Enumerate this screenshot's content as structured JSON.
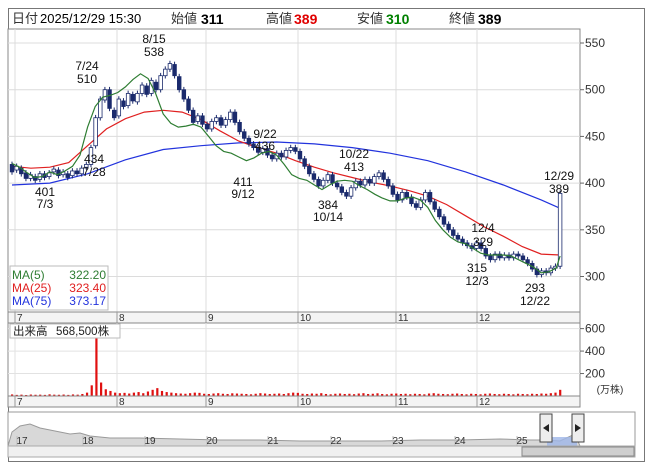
{
  "header": {
    "date_label": "日付",
    "date_value": "2025/12/29 15:30",
    "open_label": "始値",
    "open_value": "311",
    "high_label": "高値",
    "high_value": "389",
    "low_label": "安値",
    "low_value": "310",
    "close_label": "終値",
    "close_value": "389",
    "colors": {
      "high": "#e00000",
      "low": "#008000",
      "default": "#000000"
    }
  },
  "chart_data": [
    {
      "type": "candlestick",
      "title": "",
      "x_months": [
        "7",
        "8",
        "9",
        "10",
        "11",
        "12"
      ],
      "y_ticks": [
        300,
        350,
        400,
        450,
        500,
        550
      ],
      "ylim": [
        262,
        565
      ],
      "annotations": [
        {
          "date": "7/3",
          "value": "401"
        },
        {
          "date": "7/24",
          "value": "510"
        },
        {
          "date": "7/28",
          "value": "434"
        },
        {
          "date": "8/15",
          "value": "538"
        },
        {
          "date": "9/12",
          "value": "411"
        },
        {
          "date": "9/22",
          "value": "436"
        },
        {
          "date": "10/14",
          "value": "384"
        },
        {
          "date": "10/22",
          "value": "413"
        },
        {
          "date": "12/3",
          "value": "315"
        },
        {
          "date": "12/4",
          "value": "329"
        },
        {
          "date": "12/22",
          "value": "293"
        },
        {
          "date": "12/29",
          "value": "389"
        }
      ],
      "legend": [
        {
          "name": "MA(5)",
          "value": "322.20",
          "color": "#2e7d32"
        },
        {
          "name": "MA(25)",
          "value": "323.40",
          "color": "#e02020"
        },
        {
          "name": "MA(75)",
          "value": "373.17",
          "color": "#2233dd"
        }
      ],
      "ma5": [
        [
          0,
          421
        ],
        [
          2,
          417
        ],
        [
          4,
          411
        ],
        [
          6,
          406
        ],
        [
          8,
          407
        ],
        [
          10,
          412
        ],
        [
          12,
          409
        ],
        [
          14,
          413
        ],
        [
          16,
          418
        ],
        [
          18,
          430
        ],
        [
          20,
          460
        ],
        [
          22,
          482
        ],
        [
          24,
          492
        ],
        [
          26,
          494
        ],
        [
          28,
          497
        ],
        [
          30,
          503
        ],
        [
          32,
          511
        ],
        [
          34,
          517
        ],
        [
          36,
          512
        ],
        [
          38,
          496
        ],
        [
          40,
          474
        ],
        [
          42,
          464
        ],
        [
          44,
          460
        ],
        [
          46,
          461
        ],
        [
          48,
          463
        ],
        [
          50,
          460
        ],
        [
          52,
          450
        ],
        [
          54,
          440
        ],
        [
          56,
          434
        ],
        [
          58,
          432
        ],
        [
          60,
          428
        ],
        [
          62,
          424
        ],
        [
          64,
          427
        ],
        [
          66,
          432
        ],
        [
          68,
          434
        ],
        [
          70,
          430
        ],
        [
          72,
          420
        ],
        [
          74,
          409
        ],
        [
          76,
          405
        ],
        [
          78,
          403
        ],
        [
          80,
          398
        ],
        [
          82,
          393
        ],
        [
          84,
          398
        ],
        [
          86,
          402
        ],
        [
          88,
          403
        ],
        [
          90,
          402
        ],
        [
          92,
          397
        ],
        [
          94,
          393
        ],
        [
          96,
          388
        ],
        [
          98,
          384
        ],
        [
          100,
          381
        ],
        [
          102,
          381
        ],
        [
          104,
          384
        ],
        [
          106,
          385
        ],
        [
          108,
          382
        ],
        [
          110,
          374
        ],
        [
          112,
          360
        ],
        [
          114,
          350
        ],
        [
          116,
          342
        ],
        [
          118,
          337
        ],
        [
          120,
          335
        ],
        [
          122,
          330
        ],
        [
          124,
          325
        ],
        [
          126,
          323
        ],
        [
          128,
          323
        ],
        [
          130,
          323
        ],
        [
          132,
          322
        ],
        [
          134,
          318
        ],
        [
          136,
          314
        ],
        [
          138,
          310
        ],
        [
          140,
          304
        ],
        [
          142,
          305
        ],
        [
          144,
          309
        ],
        [
          145,
          322
        ]
      ],
      "ma25": [
        [
          0,
          418
        ],
        [
          5,
          416
        ],
        [
          10,
          417
        ],
        [
          15,
          422
        ],
        [
          20,
          440
        ],
        [
          25,
          458
        ],
        [
          30,
          469
        ],
        [
          35,
          476
        ],
        [
          40,
          478
        ],
        [
          45,
          476
        ],
        [
          50,
          468
        ],
        [
          55,
          456
        ],
        [
          60,
          445
        ],
        [
          65,
          438
        ],
        [
          70,
          432
        ],
        [
          75,
          424
        ],
        [
          80,
          417
        ],
        [
          85,
          411
        ],
        [
          90,
          406
        ],
        [
          95,
          401
        ],
        [
          100,
          397
        ],
        [
          105,
          392
        ],
        [
          110,
          386
        ],
        [
          115,
          377
        ],
        [
          120,
          365
        ],
        [
          125,
          353
        ],
        [
          130,
          343
        ],
        [
          135,
          332
        ],
        [
          140,
          324
        ],
        [
          145,
          323
        ]
      ],
      "ma75": [
        [
          0,
          398
        ],
        [
          10,
          400
        ],
        [
          20,
          410
        ],
        [
          30,
          425
        ],
        [
          40,
          436
        ],
        [
          50,
          440
        ],
        [
          60,
          443
        ],
        [
          70,
          444
        ],
        [
          80,
          442
        ],
        [
          90,
          438
        ],
        [
          100,
          432
        ],
        [
          110,
          424
        ],
        [
          120,
          412
        ],
        [
          130,
          398
        ],
        [
          140,
          382
        ],
        [
          145,
          373
        ]
      ],
      "candles": [
        [
          0,
          420,
          412
        ],
        [
          1,
          414,
          418
        ],
        [
          2,
          416,
          410
        ],
        [
          3,
          411,
          405
        ],
        [
          4,
          405,
          409
        ],
        [
          5,
          407,
          403
        ],
        [
          6,
          404,
          410
        ],
        [
          7,
          410,
          406
        ],
        [
          8,
          407,
          411
        ],
        [
          9,
          412,
          415
        ],
        [
          10,
          414,
          408
        ],
        [
          11,
          409,
          412
        ],
        [
          12,
          410,
          406
        ],
        [
          13,
          408,
          413
        ],
        [
          14,
          413,
          410
        ],
        [
          15,
          410,
          416
        ],
        [
          16,
          417,
          420
        ],
        [
          17,
          420,
          438
        ],
        [
          18,
          440,
          470
        ],
        [
          19,
          470,
          490
        ],
        [
          20,
          489,
          500
        ],
        [
          21,
          500,
          480
        ],
        [
          22,
          478,
          470
        ],
        [
          23,
          472,
          490
        ],
        [
          24,
          488,
          482
        ],
        [
          25,
          483,
          496
        ],
        [
          26,
          495,
          488
        ],
        [
          27,
          487,
          496
        ],
        [
          28,
          496,
          505
        ],
        [
          29,
          504,
          495
        ],
        [
          30,
          496,
          510
        ],
        [
          31,
          508,
          500
        ],
        [
          32,
          500,
          515
        ],
        [
          33,
          515,
          522
        ],
        [
          34,
          522,
          528
        ],
        [
          35,
          527,
          515
        ],
        [
          36,
          514,
          500
        ],
        [
          37,
          500,
          490
        ],
        [
          38,
          490,
          478
        ],
        [
          39,
          478,
          465
        ],
        [
          40,
          466,
          472
        ],
        [
          41,
          472,
          463
        ],
        [
          42,
          463,
          458
        ],
        [
          43,
          458,
          466
        ],
        [
          44,
          466,
          470
        ],
        [
          45,
          470,
          462
        ],
        [
          46,
          462,
          468
        ],
        [
          47,
          468,
          476
        ],
        [
          48,
          476,
          465
        ],
        [
          49,
          465,
          455
        ],
        [
          50,
          455,
          448
        ],
        [
          51,
          448,
          442
        ],
        [
          52,
          442,
          438
        ],
        [
          53,
          438,
          433
        ],
        [
          54,
          433,
          437
        ],
        [
          55,
          437,
          430
        ],
        [
          56,
          430,
          426
        ],
        [
          57,
          426,
          432
        ],
        [
          58,
          432,
          428
        ],
        [
          59,
          428,
          435
        ],
        [
          60,
          435,
          438
        ],
        [
          61,
          438,
          434
        ],
        [
          62,
          434,
          426
        ],
        [
          63,
          426,
          418
        ],
        [
          64,
          418,
          410
        ],
        [
          65,
          410,
          404
        ],
        [
          66,
          404,
          397
        ],
        [
          67,
          397,
          403
        ],
        [
          68,
          403,
          409
        ],
        [
          69,
          409,
          400
        ],
        [
          70,
          400,
          396
        ],
        [
          71,
          396,
          390
        ],
        [
          72,
          390,
          386
        ],
        [
          73,
          386,
          395
        ],
        [
          74,
          395,
          402
        ],
        [
          75,
          402,
          398
        ],
        [
          76,
          398,
          404
        ],
        [
          77,
          404,
          400
        ],
        [
          78,
          400,
          407
        ],
        [
          79,
          407,
          411
        ],
        [
          80,
          411,
          404
        ],
        [
          81,
          404,
          397
        ],
        [
          82,
          397,
          388
        ],
        [
          83,
          388,
          382
        ],
        [
          84,
          382,
          390
        ],
        [
          85,
          390,
          385
        ],
        [
          86,
          385,
          378
        ],
        [
          87,
          378,
          374
        ],
        [
          88,
          374,
          382
        ],
        [
          89,
          382,
          390
        ],
        [
          90,
          390,
          380
        ],
        [
          91,
          380,
          372
        ],
        [
          92,
          372,
          364
        ],
        [
          93,
          364,
          356
        ],
        [
          94,
          356,
          350
        ],
        [
          95,
          350,
          344
        ],
        [
          96,
          344,
          340
        ],
        [
          97,
          340,
          336
        ],
        [
          98,
          336,
          333
        ],
        [
          99,
          333,
          330
        ],
        [
          100,
          330,
          336
        ],
        [
          101,
          336,
          330
        ],
        [
          102,
          330,
          322
        ],
        [
          103,
          322,
          318
        ],
        [
          104,
          318,
          324
        ],
        [
          105,
          324,
          320
        ],
        [
          106,
          320,
          323
        ],
        [
          107,
          323,
          320
        ],
        [
          108,
          320,
          324
        ],
        [
          109,
          324,
          322
        ],
        [
          110,
          322,
          318
        ],
        [
          111,
          318,
          314
        ],
        [
          112,
          314,
          308
        ],
        [
          113,
          308,
          302
        ],
        [
          114,
          302,
          306
        ],
        [
          115,
          306,
          304
        ],
        [
          116,
          304,
          309
        ],
        [
          117,
          309,
          311
        ],
        [
          118,
          311,
          389
        ]
      ]
    },
    {
      "type": "bar",
      "title": "出来高",
      "current_volume": "568,500株",
      "unit": "(万株)",
      "y_ticks": [
        200,
        400,
        600
      ],
      "ylim": [
        0,
        650
      ],
      "values": [
        14,
        10,
        12,
        9,
        13,
        11,
        12,
        10,
        15,
        12,
        11,
        13,
        10,
        14,
        12,
        18,
        30,
        95,
        610,
        120,
        60,
        45,
        30,
        25,
        28,
        22,
        30,
        35,
        25,
        40,
        55,
        70,
        45,
        35,
        30,
        25,
        22,
        20,
        25,
        30,
        28,
        20,
        18,
        22,
        25,
        20,
        18,
        24,
        22,
        20,
        18,
        15,
        20,
        25,
        22,
        18,
        20,
        22,
        18,
        25,
        30,
        28,
        20,
        18,
        22,
        20,
        25,
        18,
        15,
        20,
        22,
        18,
        20,
        16,
        22,
        25,
        18,
        20,
        24,
        18,
        15,
        20,
        22,
        18,
        20,
        16,
        20,
        18,
        15,
        22,
        25,
        20,
        18,
        16,
        20,
        22,
        18,
        15,
        20,
        18,
        15,
        20,
        22,
        18,
        16,
        20,
        18,
        15,
        20,
        18,
        16,
        20,
        18,
        22,
        20,
        25,
        30,
        55
      ]
    },
    {
      "type": "area",
      "title": "",
      "x_labels": [
        "17",
        "18",
        "19",
        "20",
        "21",
        "22",
        "23",
        "24",
        "25"
      ]
    }
  ]
}
